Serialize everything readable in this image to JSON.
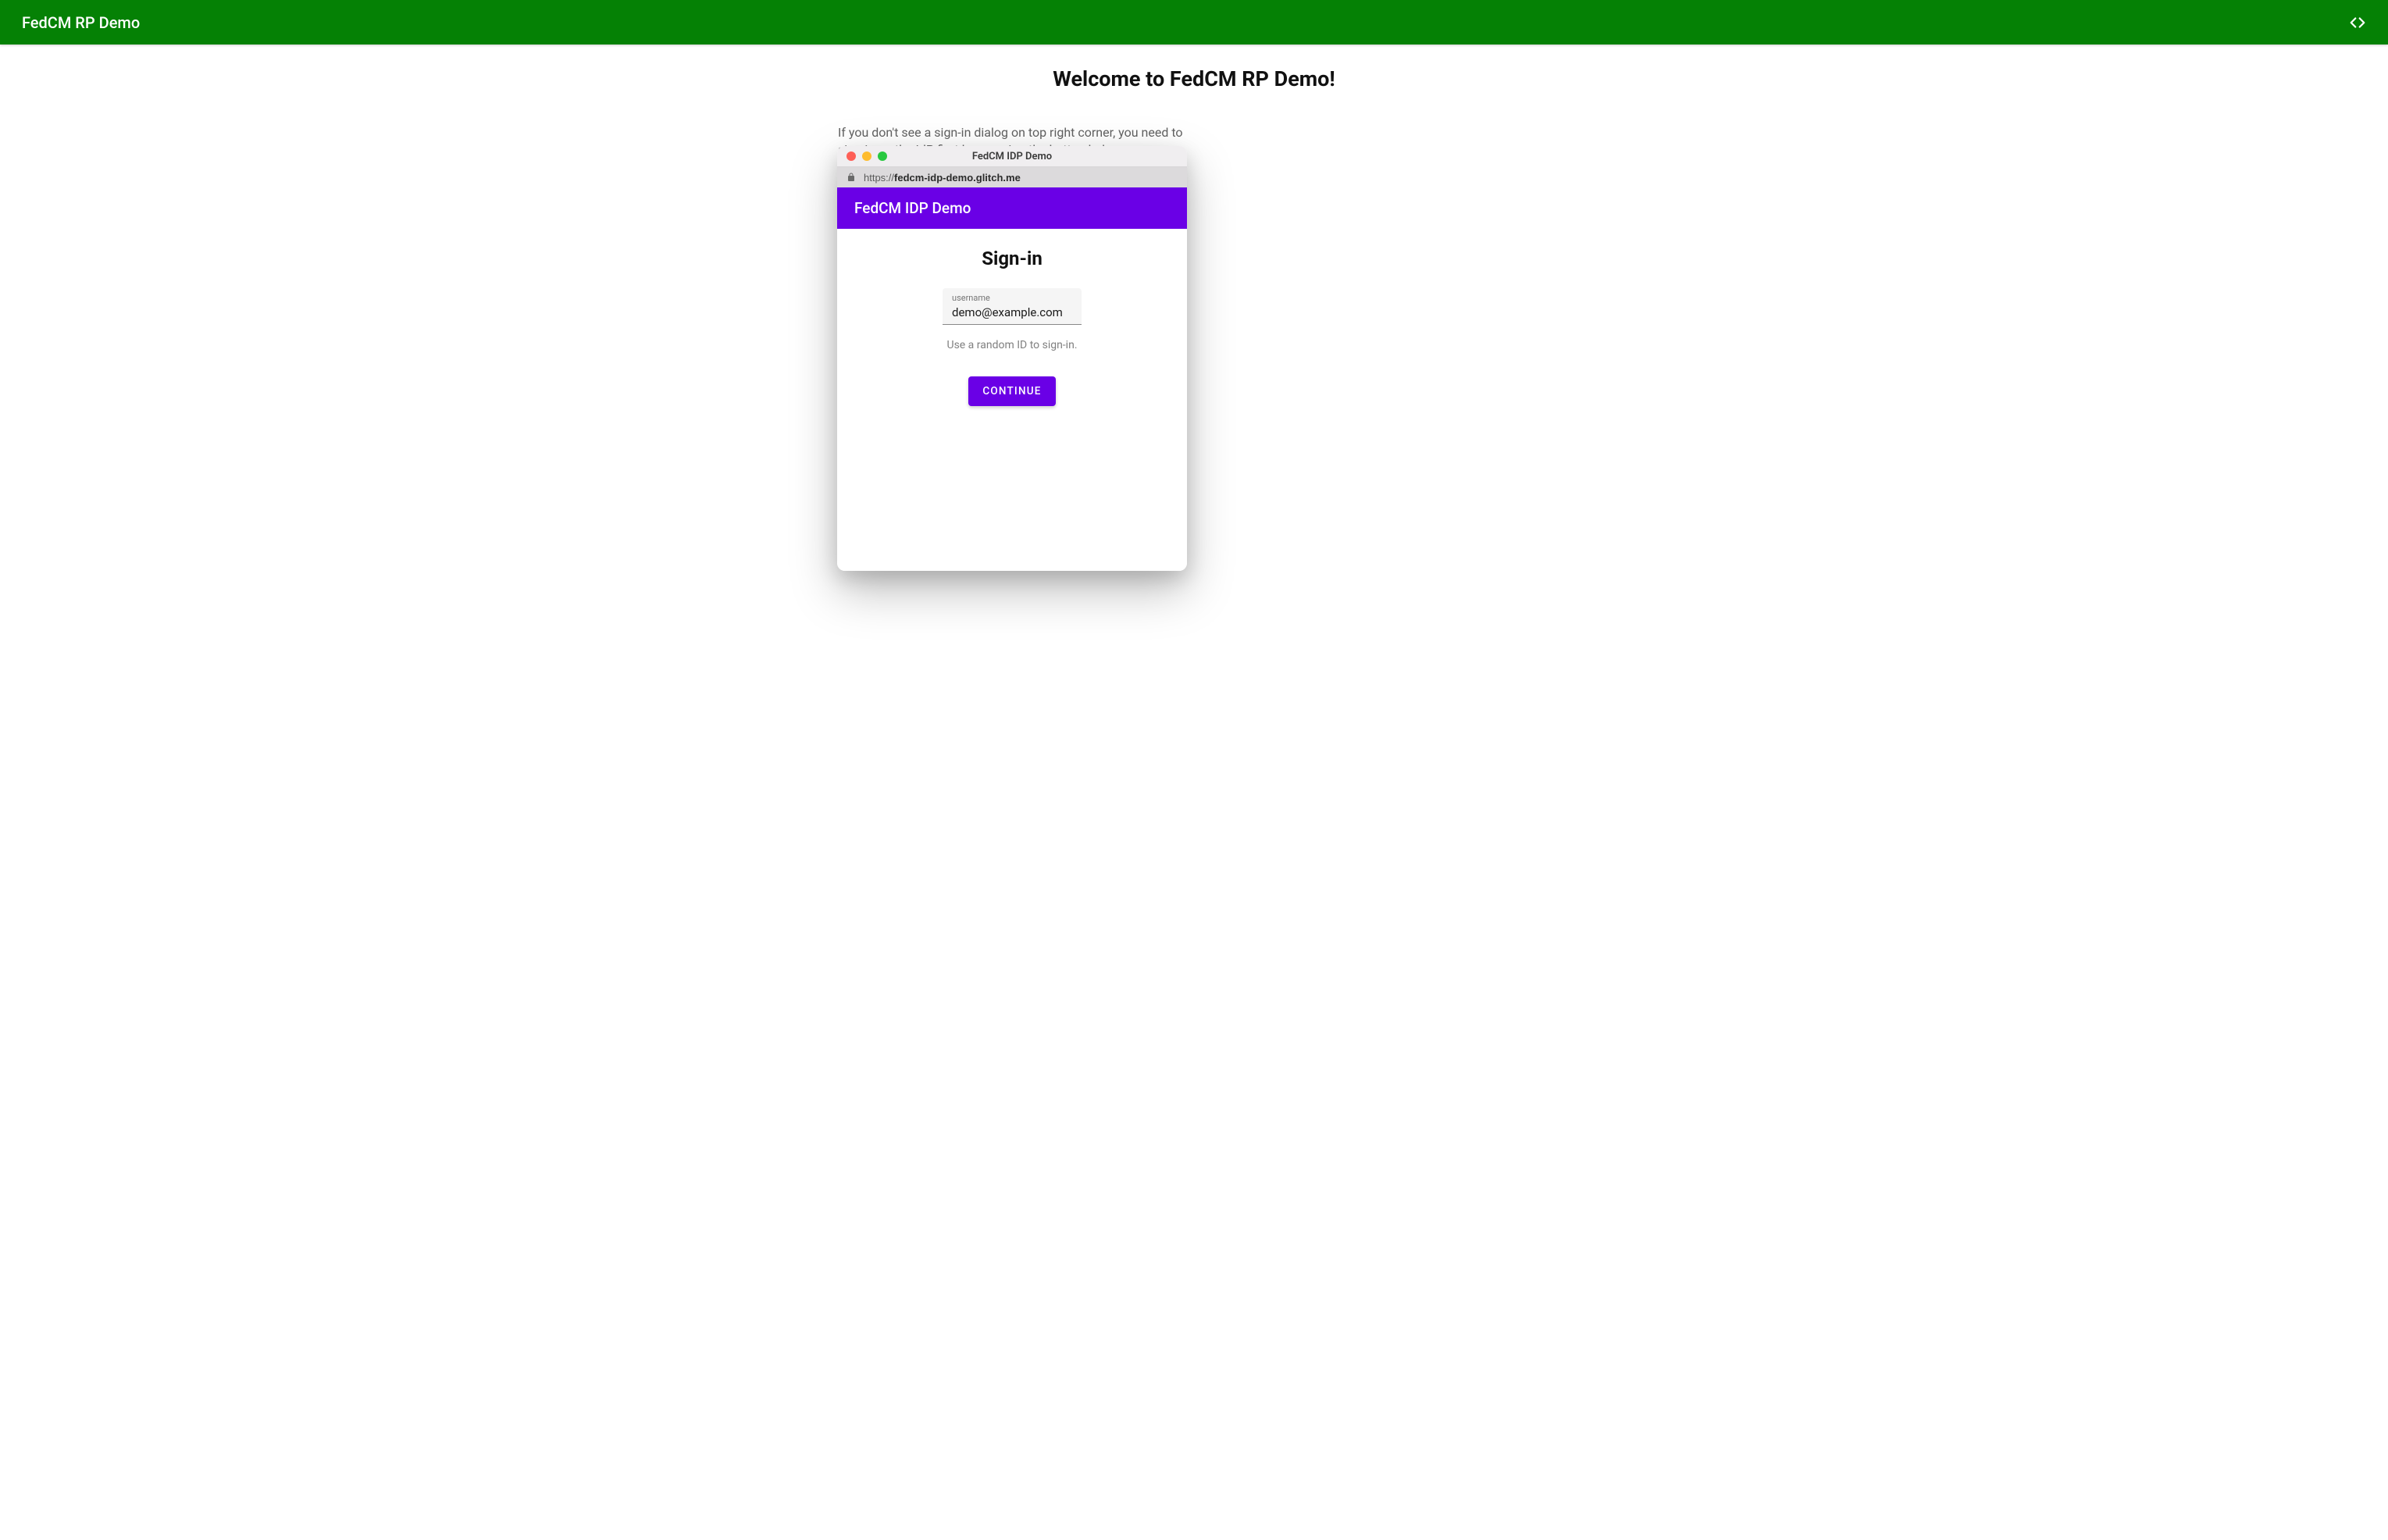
{
  "topBar": {
    "title": "FedCM RP Demo"
  },
  "main": {
    "welcomeHeading": "Welcome to FedCM RP Demo!",
    "instructionText": "If you don't see a sign-in dialog on top right corner, you need to sign-in on the IdP first by pressing the button below."
  },
  "popup": {
    "windowTitle": "FedCM IDP Demo",
    "urlScheme": "https://",
    "urlDomain": "fedcm-idp-demo.glitch.me",
    "idpHeaderTitle": "FedCM IDP Demo",
    "signinHeading": "Sign-in",
    "usernameLabel": "username",
    "usernameValue": "demo@example.com",
    "helperText": "Use a random ID to sign-in.",
    "continueLabel": "CONTINUE"
  },
  "colors": {
    "topBarBg": "#058105",
    "idpAccent": "#6a00e6"
  }
}
